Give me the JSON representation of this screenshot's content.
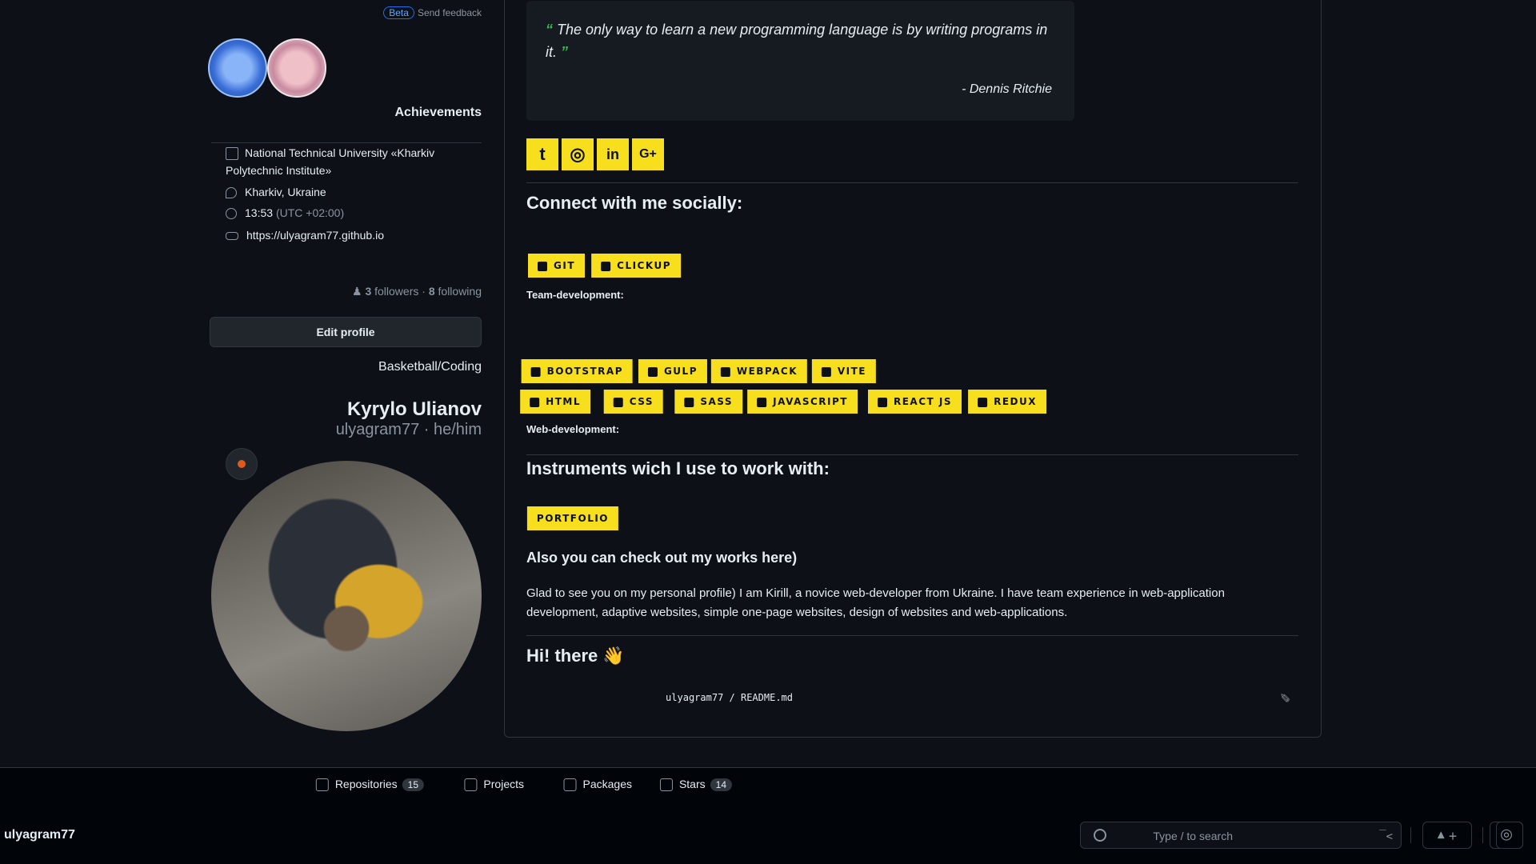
{
  "header": {
    "username": "ulyagram77",
    "search_placeholder": "Type / to search",
    "search_cmd": ">_",
    "plus": "+ ▾"
  },
  "tabs": [
    {
      "label": "Repositories",
      "count": "15"
    },
    {
      "label": "Projects"
    },
    {
      "label": "Packages"
    },
    {
      "label": "Stars",
      "count": "14"
    }
  ],
  "profile": {
    "fullname": "Kyrylo Ulianov",
    "nickname": "ulyagram77 · he/him",
    "bio": "Basketball/Coding",
    "edit_button": "Edit profile",
    "followers": "3",
    "followers_label": "followers",
    "following": "8",
    "following_label": "following",
    "org": "National Technical University «Kharkiv Polytechnic Institute»",
    "location": "Kharkiv, Ukraine",
    "time": "13:53",
    "timezone": "(UTC +02:00)",
    "website": "https://ulyagram77.github.io",
    "achievements_title": "Achievements",
    "beta_label": "Beta",
    "feedback_label": "Send feedback"
  },
  "readme": {
    "path": "ulyagram77 / README.md",
    "greeting": "Hi! there 👋",
    "intro_line1": "Glad to see you on my personal profile) I am Kirill, a novice web-developer from Ukraine. I have team experience in web-application",
    "intro_line2": "development, adaptive websites, simple one-page websites, design of websites and web-applications.",
    "portfolio_heading": "Also you can check out my works here)",
    "portfolio_badge": "PORTFOLIO",
    "instruments_heading": "Instruments wich I use to work with:",
    "web_dev_label": "Web-development:",
    "web_badges_row1": [
      "HTML",
      "CSS",
      "SASS",
      "JAVASCRIPT",
      "REACT JS",
      "REDUX"
    ],
    "web_badges_row2": [
      "BOOTSTRAP",
      "GULP",
      "WEBPACK",
      "VITE"
    ],
    "team_dev_label": "Team-development:",
    "team_badges": [
      "GIT",
      "CLICKUP"
    ],
    "social_heading": "Connect with me socially:",
    "social_icons": [
      "t",
      "◎",
      "in",
      "G+"
    ],
    "quote_open": "“",
    "quote_text": "The only way to learn a new programming language is by writing programs in it.",
    "quote_close": "”",
    "quote_author": "- Dennis Ritchie"
  },
  "colors": {
    "badge_yellow": "#f7df1e",
    "bg": "#0d1117",
    "quote_green": "#3fb950"
  }
}
